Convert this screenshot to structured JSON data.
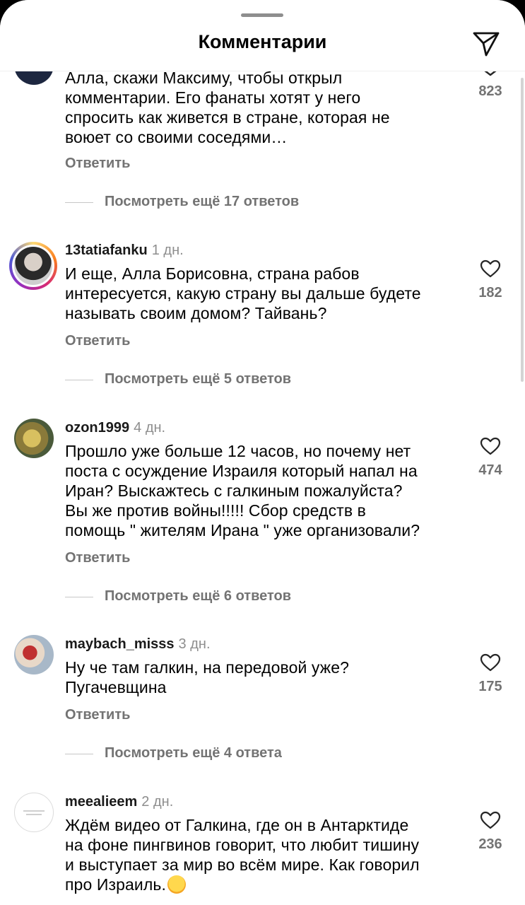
{
  "header": {
    "title": "Комментарии",
    "share_icon": "paper-plane-icon"
  },
  "comments": [
    {
      "username": "",
      "time": "",
      "text": "Алла, скажи Максиму, чтобы открыл\nкомментарии. Его фанаты хотят у него\nспросить как живется в стране, которая не\nвоюет со своими соседями…",
      "likes": "823",
      "reply": "Ответить",
      "more_replies": "Посмотреть ещё 17 ответов"
    },
    {
      "username": "13tatiafanku",
      "time": "1 дн.",
      "text": "И еще, Алла Борисовна, страна рабов\nинтересуется, какую страну вы дальше будете\nназывать своим домом? Тайвань?",
      "likes": "182",
      "reply": "Ответить",
      "more_replies": "Посмотреть ещё 5 ответов"
    },
    {
      "username": "ozon1999",
      "time": "4 дн.",
      "text": "Прошло уже больше 12 часов, но почему нет\nпоста с осуждение Израиля который напал на\nИран? Выскажтесь с галкиным пожалуйста?\nВы же против войны!!!!! Сбор средств в\nпомощь \" жителям Ирана \" уже организовали?",
      "likes": "474",
      "reply": "Ответить",
      "more_replies": "Посмотреть ещё 6 ответов"
    },
    {
      "username": "maybach_misss",
      "time": "3 дн.",
      "text": "Ну че там галкин, на передовой уже?\nПугачевщина",
      "likes": "175",
      "reply": "Ответить",
      "more_replies": "Посмотреть ещё 4 ответа"
    },
    {
      "username": "meealieem",
      "time": "2 дн.",
      "text": "Ждём видео от Галкина, где он в Антарктиде\nна фоне пингвинов говорит, что любит тишину\nи выступает за мир во всём мире. Как говорил\nпро Израиль.",
      "likes": "236",
      "emoji": "face-with-tears-of-joy"
    }
  ],
  "colors": {
    "text": "#000000",
    "secondary": "#737373",
    "divider": "#c7c7c7"
  }
}
